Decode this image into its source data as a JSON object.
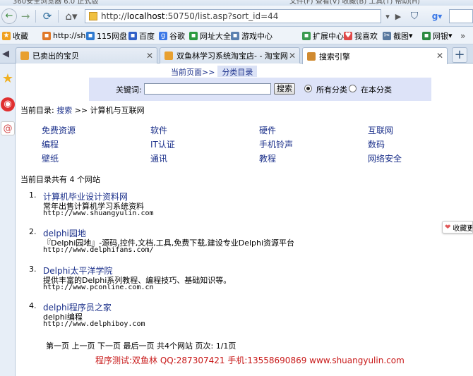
{
  "window": {
    "title_text": "360安全浏览器 6.0 正式版",
    "menu_text": "文件(F)  查看(V)  收藏(B)  工具(T)  帮助(H)"
  },
  "navbar": {
    "address_prefix": "http://",
    "address_host": "localhost",
    "address_path": ":50750/list.asp?sort_id=44"
  },
  "bookmarks": {
    "items": [
      {
        "label": "收藏",
        "color": "#f0a020"
      },
      {
        "label": "http://sh",
        "color": "#e07828"
      },
      {
        "label": "115网盘",
        "color": "#2f7ad0"
      },
      {
        "label": "百度",
        "color": "#3060c8"
      },
      {
        "label": "谷歌",
        "color": "#3b78e7"
      },
      {
        "label": "网址大全",
        "color": "#2a9a40"
      },
      {
        "label": "游戏中心",
        "color": "#5a80b0"
      }
    ],
    "right_items": [
      {
        "label": "扩展中心",
        "color": "#3a9a50"
      },
      {
        "label": "我喜欢",
        "color": "#e04848"
      },
      {
        "label": "截图",
        "color": "#5a7aa0"
      },
      {
        "label": "网银",
        "color": "#2a8a40"
      }
    ]
  },
  "tabs": [
    {
      "label": "已卖出的宝贝",
      "active": false
    },
    {
      "label": "双鱼林学习系统淘宝店- - 淘宝网",
      "active": false
    },
    {
      "label": "搜索引擎",
      "active": true
    }
  ],
  "page": {
    "current_page_label": "当前页面>>",
    "category_tab": "分类目录",
    "keyword_label": "关键词:",
    "keyword_value": "",
    "search_button": "搜索",
    "radio_all": "所有分类",
    "radio_this": "在本分类",
    "crumb_label": "当前目录:",
    "crumb_link": "搜索",
    "crumb_sep": ">>",
    "crumb_current": "计算机与互联网",
    "categories": [
      [
        "免费资源",
        "软件",
        "硬件",
        "互联网"
      ],
      [
        "编程",
        "IT认证",
        "手机铃声",
        "数码"
      ],
      [
        "壁纸",
        "通讯",
        "教程",
        "网络安全"
      ]
    ],
    "total_text": "当前目录共有 4 个网站",
    "sites": [
      {
        "num": "1.",
        "title": "计算机毕业设计资料网",
        "desc": "常年出售计算机学习系统资料",
        "url": "http://www.shuangyulin.com"
      },
      {
        "num": "2.",
        "title": "delphi园地",
        "desc": "『Delphi园地』-源码,控件,文档,工具,免费下载,建设专业Delphi资源平台",
        "url": "http://www.delphifans.com/"
      },
      {
        "num": "3.",
        "title": "Delphi太平洋学院",
        "desc": "提供丰富的Delphi系列教程、编程技巧、基础知识等。",
        "url": "http://www.pconline.com.cn"
      },
      {
        "num": "4.",
        "title": "delphi程序员之家",
        "desc": "delphi编程",
        "url": "http://www.delphiboy.com"
      }
    ],
    "pager": {
      "first": "第一页",
      "prev": "上一页",
      "next": "下一页",
      "last": "最后一页",
      "summary": "共4个网站 页次: 1/1页"
    },
    "footer": "程序测试:双鱼林 QQ:287307421 手机:13558690869 www.shuangyulin.com",
    "collect": "收藏更"
  }
}
